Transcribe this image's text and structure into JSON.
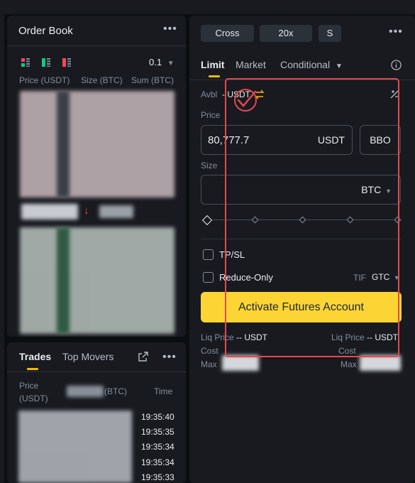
{
  "orderbook": {
    "title": "Order Book",
    "precision": "0.1",
    "col_price": "Price (USDT)",
    "col_size": "Size (BTC)",
    "col_sum": "Sum (BTC)"
  },
  "trades": {
    "tab_trades": "Trades",
    "tab_movers": "Top Movers",
    "col_price_l1": "Price",
    "col_price_l2": "(USDT)",
    "col_size_suffix": "(BTC)",
    "col_time": "Time",
    "times": [
      "19:35:40",
      "19:35:35",
      "19:35:34",
      "19:35:34",
      "19:35:33"
    ]
  },
  "form": {
    "margin_mode": "Cross",
    "leverage": "20x",
    "mode_s": "S",
    "tabs": {
      "limit": "Limit",
      "market": "Market",
      "conditional": "Conditional"
    },
    "avbl_label": "Avbl",
    "avbl_value": "- USDT",
    "price_label": "Price",
    "price_value": "80,777.7",
    "price_unit": "USDT",
    "bbo": "BBO",
    "size_label": "Size",
    "size_unit": "BTC",
    "tpsl": "TP/SL",
    "reduce_only": "Reduce-Only",
    "tif_label": "TIF",
    "tif_value": "GTC",
    "activate_button": "Activate Futures Account",
    "liq_price_left": "Liq Price",
    "liq_value_left": "-- USDT",
    "liq_price_right": "Liq Price",
    "liq_value_right": "-- USDT",
    "cost_left": "Cost",
    "cost_right": "Cost",
    "max_left": "Max",
    "max_right": "Max"
  },
  "colors": {
    "accent": "#f0b90b",
    "button_yellow": "#fcd535",
    "annotation_red": "#e5484d",
    "down_red": "#f6465d"
  }
}
